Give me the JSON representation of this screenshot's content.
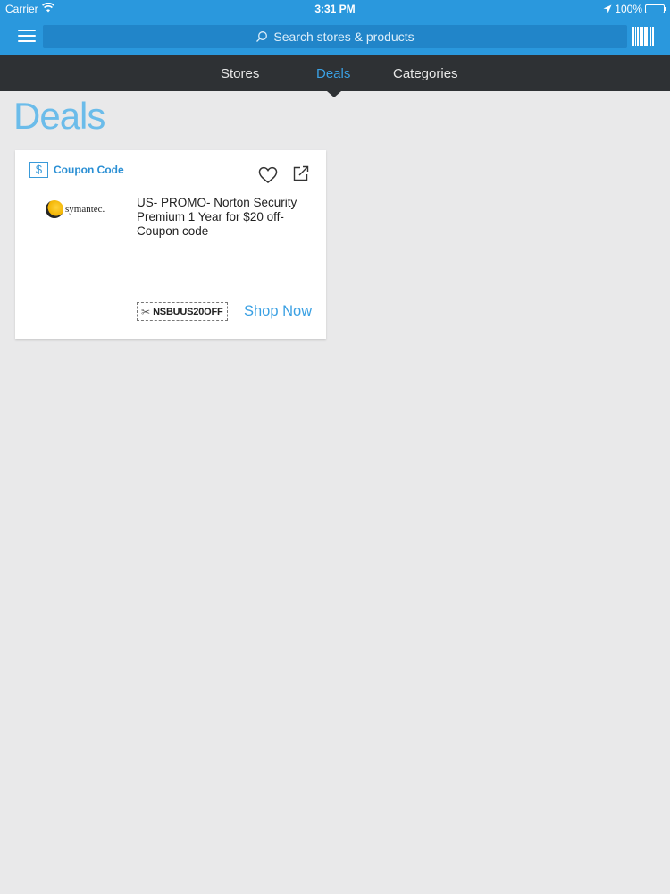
{
  "status_bar": {
    "carrier": "Carrier",
    "time": "3:31 PM",
    "battery": "100%",
    "battery_level": 1.0
  },
  "header": {
    "search_placeholder": "Search stores & products",
    "icons": [
      "menu-icon",
      "search-icon",
      "barcode-icon"
    ]
  },
  "tabs": [
    {
      "label": "Stores",
      "active": false
    },
    {
      "label": "Deals",
      "active": true
    },
    {
      "label": "Categories",
      "active": false
    }
  ],
  "page": {
    "title": "Deals"
  },
  "deals": [
    {
      "type": "Coupon Code",
      "store": "symantec.",
      "title": "US- PROMO- Norton Security Premium 1 Year for $20 off- Coupon code",
      "code": "NSBUUS20OFF",
      "action": "Shop Now"
    }
  ],
  "colors": {
    "brand_blue": "#2a98dd",
    "tab_bar": "#2e3134",
    "accent": "#3aa0e3",
    "background": "#e9e9ea"
  }
}
